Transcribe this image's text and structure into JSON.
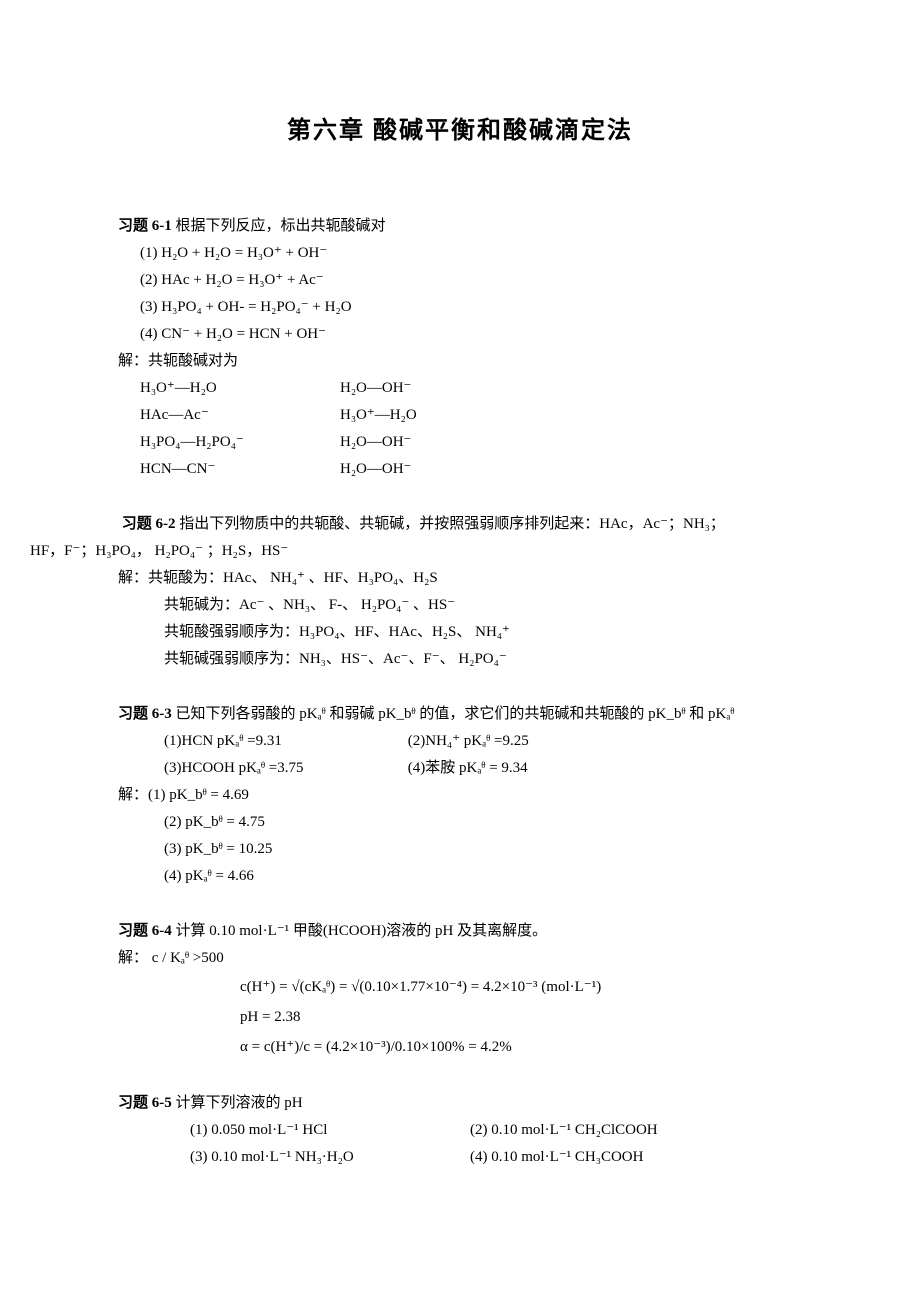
{
  "chapter_title": "第六章  酸碱平衡和酸碱滴定法",
  "p61": {
    "label": "习题 6-1",
    "prompt": "根据下列反应，标出共轭酸碱对",
    "eq1": "(1)    H₂O + H₂O  = H₃O⁺ + OH⁻",
    "eq2": "(2)    HAc + H₂O  = H₃O⁺ + Ac⁻",
    "eq3": "(3)    H₃PO₄ + OH-  = H₂PO₄⁻ + H₂O",
    "eq4": "(4)    CN⁻ + H₂O  = HCN + OH⁻",
    "sol_label": "解：共轭酸碱对为",
    "r1a": "H₃O⁺—H₂O",
    "r1b": "H₂O—OH⁻",
    "r2a": "HAc—Ac⁻",
    "r2b": "H₃O⁺—H₂O",
    "r3a": "H₃PO₄—H₂PO₄⁻",
    "r3b": "H₂O—OH⁻",
    "r4a": "HCN—CN⁻",
    "r4b": "H₂O—OH⁻"
  },
  "p62": {
    "label": "习题 6-2",
    "prompt_a": "指出下列物质中的共轭酸、共轭碱，并按照强弱顺序排列起来：HAc，Ac⁻；NH₃；",
    "prompt_b": "HF，F⁻；H₃PO₄， H₂PO₄⁻ ；H₂S，HS⁻",
    "a1": "解：共轭酸为：HAc、 NH₄⁺ 、HF、H₃PO₄、H₂S",
    "a2": "共轭碱为：Ac⁻ 、NH₃、  F-、 H₂PO₄⁻ 、HS⁻",
    "a3": "共轭酸强弱顺序为：H₃PO₄、HF、HAc、H₂S、 NH₄⁺",
    "a4": "共轭碱强弱顺序为：NH₃、HS⁻、Ac⁻、F⁻、 H₂PO₄⁻"
  },
  "p63": {
    "label": "习题 6-3",
    "prompt": "已知下列各弱酸的 pKₐᶿ 和弱碱 pK_bᶿ 的值，求它们的共轭碱和共轭酸的 pK_bᶿ 和 pKₐᶿ",
    "d1a": "(1)HCN   pKₐᶿ =9.31",
    "d1b": "(2)NH₄⁺     pKₐᶿ =9.25",
    "d2a": "(3)HCOOH   pKₐᶿ =3.75",
    "d2b": "(4)苯胺        pKₐᶿ = 9.34",
    "s_lead": "解：(1)     pK_bᶿ = 4.69",
    "s2": "(2)    pK_bᶿ = 4.75",
    "s3": "(3)    pK_bᶿ = 10.25",
    "s4": "(4)    pKₐᶿ  = 4.66"
  },
  "p64": {
    "label": "习题 6-4",
    "prompt": "计算 0.10 mol·L⁻¹ 甲酸(HCOOH)溶液的 pH 及其离解度。",
    "sol_lead": "解：    c / Kₐᶿ >500",
    "f1": "c(H⁺) = √(cKₐᶿ) = √(0.10×1.77×10⁻⁴) = 4.2×10⁻³ (mol·L⁻¹)",
    "f2": "pH = 2.38",
    "f3": "α = c(H⁺)/c = (4.2×10⁻³)/0.10×100% = 4.2%"
  },
  "p65": {
    "label": "习题 6-5",
    "prompt": "计算下列溶液的 pH",
    "i1": "(1) 0.050 mol·L⁻¹ HCl",
    "i2": "(2) 0.10 mol·L⁻¹ CH₂ClCOOH",
    "i3": "(3) 0.10 mol·L⁻¹ NH₃·H₂O",
    "i4": "(4) 0.10 mol·L⁻¹ CH₃COOH"
  }
}
